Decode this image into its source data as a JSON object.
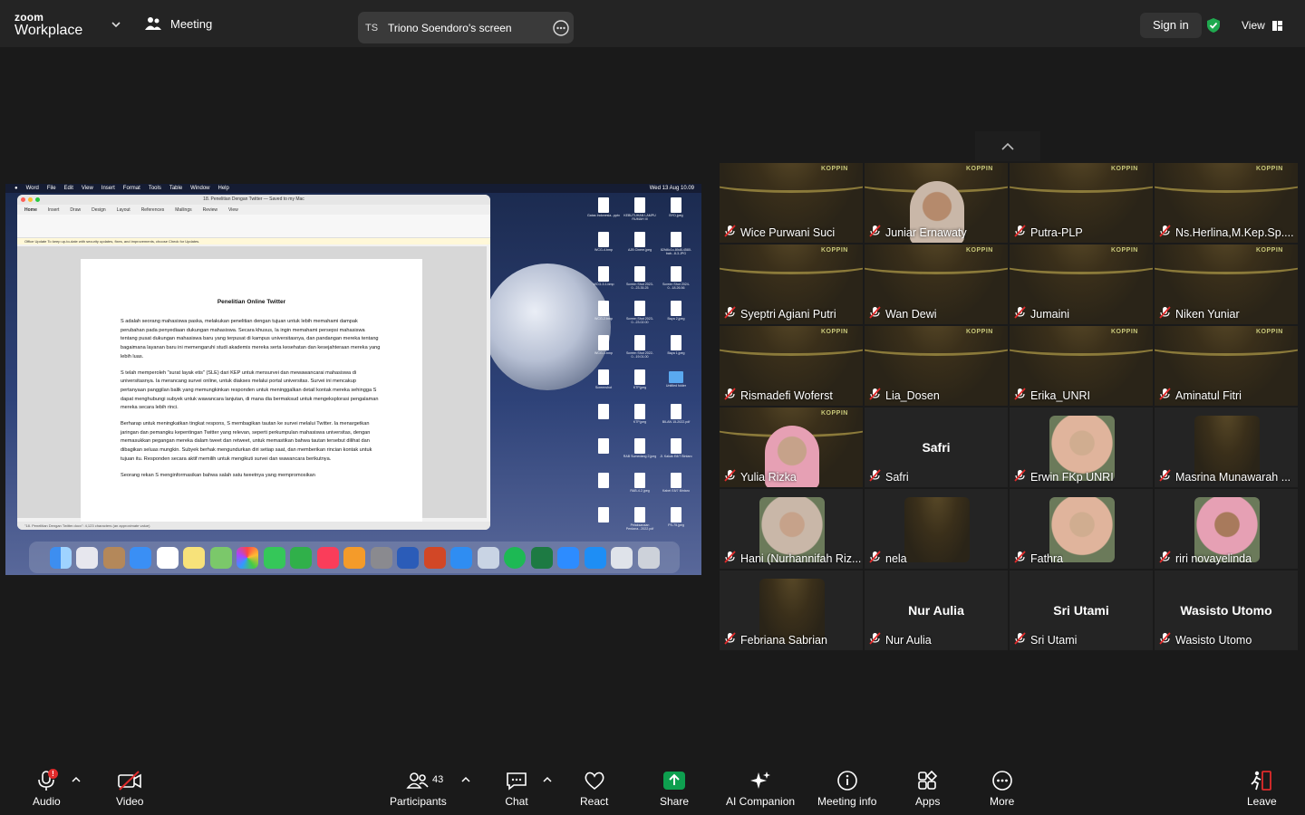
{
  "app": {
    "logo_top": "zoom",
    "logo_bottom": "Workplace"
  },
  "header": {
    "meeting_label": "Meeting",
    "share_initials": "TS",
    "share_label": "Triono Soendoro's screen",
    "signin_label": "Sign in",
    "view_label": "View"
  },
  "shared_screen": {
    "mac_menu": [
      "Word",
      "File",
      "Edit",
      "View",
      "Insert",
      "Format",
      "Tools",
      "Table",
      "Window",
      "Help"
    ],
    "clock": "Wed 13 Aug 10.09",
    "window_title": "18. Penelitian Dengan Twitter — Saved to my Mac",
    "tabs": [
      "Home",
      "Insert",
      "Draw",
      "Design",
      "Layout",
      "References",
      "Mailings",
      "Review",
      "View"
    ],
    "notice": "Office Update  To keep up-to-date with security updates, fixes, and improvements, choose Check for Updates.",
    "doc_title": "Penelitian Online Twitter",
    "paragraphs": [
      "S adalah seorang mahasiswa paska, melakukan penelitian dengan tujuan untuk lebih memahami dampak perubahan pada penyediaan dukungan mahasiswa. Secara khusus, Ia ingin memahami persepsi mahasiswa tentang pusat dukungan mahasiswa baru yang terpusat di kampus universitasnya, dan pandangan mereka tentang bagaimana layanan baru ini memengaruhi studi akademis mereka serta kesehatan dan kesejahteraan mereka yang lebih luas.",
      "S telah memperoleh \"surat layak etis\" (SLE) dari KEP untuk mensurvei dan mewawancarai mahasiswa di universitasnya. Ia merancang survei online, untuk diakses melalui portal universitas. Survei ini mencakup pertanyaan panggilan balik yang memungkinkan responden untuk meninggalkan detail kontak mereka sehingga S dapat menghubungi subyek untuk wawancara lanjutan, di mana dia bermaksud untuk mengeksplorasi pengalaman mereka secara lebih rinci.",
      "Berharap untuk meningkatkan tingkat respons, S membagikan tautan ke survei melalui Twitter. Ia menargetkan jaringan dan pemangku kepentingan Twitter yang relevan, seperti perkumpulan mahasiswa universitas, dengan memasukkan pegangan mereka dalam tweet dan retweet, untuk memastikan bahwa tautan tersebut dilihat dan dibagikan seluas mungkin. Subyek berhak mengundurkan diri setiap saat, dan memberikan rincian kontak untuk tujuan itu. Responden secara aktif memilih untuk mengikuti survei dan wawancara berikutnya.",
      "Seorang rekan S menginformasikan bahwa salah satu tweetnya yang mempromosikan"
    ],
    "status_bar": "\"18. Penelitian Dengan Twitter.docx\": 4,123 characters (an approximate value)",
    "desktop_icons": [
      "Gatas Indonesia...pptx",
      "KEBUTUHAN LAMPU RUMAH III",
      "BYD.jpeg",
      "WCG-4.bmp",
      "AJB Cinere.jpeg",
      "82fd6c1c-89d8-4580-bab...8-3.JPG",
      "WCG-3.1.bmp",
      "Screen Shot 2023-0...23.35.25",
      "Screen Shot 2024-0...18.26.56",
      "WCG-2.bmp",
      "Screen Shot 2023-0...23.02.00",
      "Baya 2.jpeg",
      "WCG-1.bmp",
      "Screen Shot 2022-0...19.01.00",
      "Baya 1.jpeg",
      "Screenshot",
      "KTP.jpeg",
      "Untitled folder",
      "",
      "KTP.jpeg",
      "BILAN 15-2022.pdf",
      "",
      "RAB Sumedang 2.jpeg",
      "Jl. Kakak E8/7 Bintaro",
      "",
      "RAB-4.2.jpeg",
      "Kabel E8/7 Bintaro",
      "",
      "Pelaksanaan Perdana...2022.pdf",
      "PS-75.jpeg"
    ]
  },
  "gallery": {
    "tiles": [
      {
        "name": "Wice Purwani Suci",
        "type": "banner"
      },
      {
        "name": "Juniar Ernawaty",
        "type": "person"
      },
      {
        "name": "Putra-PLP",
        "type": "banner"
      },
      {
        "name": "Ns.Herlina,M.Kep.Sp....",
        "type": "banner"
      },
      {
        "name": "Syeptri Agiani Putri",
        "type": "banner"
      },
      {
        "name": "Wan Dewi",
        "type": "banner"
      },
      {
        "name": "Jumaini",
        "type": "banner"
      },
      {
        "name": "Niken Yuniar",
        "type": "banner"
      },
      {
        "name": "Rismadefi Woferst",
        "type": "banner"
      },
      {
        "name": "Lia_Dosen",
        "type": "banner"
      },
      {
        "name": "Erika_UNRI",
        "type": "banner"
      },
      {
        "name": "Aminatul Fitri",
        "type": "banner"
      },
      {
        "name": "Yulia Rizka",
        "type": "person"
      },
      {
        "name": "Safri",
        "type": "text",
        "big": "Safri"
      },
      {
        "name": "Erwin FKp UNRI",
        "type": "thumb"
      },
      {
        "name": "Masrina Munawarah ...",
        "type": "thumbbanner"
      },
      {
        "name": "Hani (Nurhannifah Riz...",
        "type": "thumb"
      },
      {
        "name": "nela",
        "type": "thumbbanner"
      },
      {
        "name": "Fathra",
        "type": "thumb"
      },
      {
        "name": "riri novayelinda",
        "type": "thumb"
      },
      {
        "name": "Febriana Sabrian",
        "type": "thumbbanner"
      },
      {
        "name": "Nur Aulia",
        "type": "text",
        "big": "Nur Aulia"
      },
      {
        "name": "Sri Utami",
        "type": "text",
        "big": "Sri Utami"
      },
      {
        "name": "Wasisto Utomo",
        "type": "text",
        "big": "Wasisto Utomo"
      }
    ]
  },
  "toolbar": {
    "audio": "Audio",
    "audio_badge": "!",
    "video": "Video",
    "participants": "Participants",
    "participants_count": "43",
    "chat": "Chat",
    "react": "React",
    "share": "Share",
    "ai_companion": "AI Companion",
    "meeting_info": "Meeting info",
    "apps": "Apps",
    "more": "More",
    "leave": "Leave"
  },
  "colors": {
    "share_green": "#0e9f4f",
    "mute_red": "#e02b2b",
    "shield_green": "#1fa94f"
  }
}
